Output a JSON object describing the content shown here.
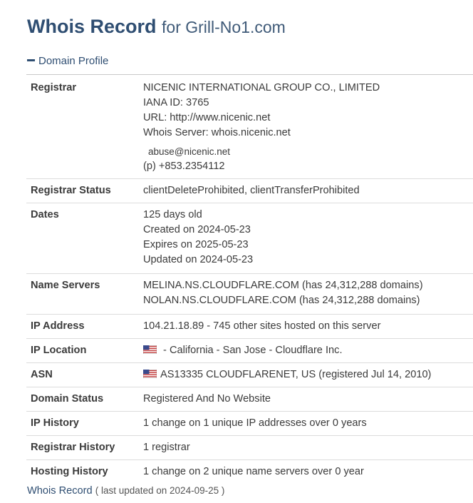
{
  "title": {
    "main": "Whois Record",
    "suffix": "for Grill-No1.com"
  },
  "section": {
    "label": "Domain Profile"
  },
  "rows": {
    "registrar": {
      "label": "Registrar",
      "name": "NICENIC INTERNATIONAL GROUP CO., LIMITED",
      "iana": "IANA ID: 3765",
      "url": "URL: http://www.nicenic.net",
      "whois_server": "Whois Server: whois.nicenic.net",
      "email": "abuse@nicenic.net",
      "phone": "(p)  +853.2354112"
    },
    "registrar_status": {
      "label": "Registrar Status",
      "value": "clientDeleteProhibited, clientTransferProhibited"
    },
    "dates": {
      "label": "Dates",
      "age": "125 days old",
      "created": "Created on 2024-05-23",
      "expires": "Expires on 2025-05-23",
      "updated": "Updated on 2024-05-23"
    },
    "name_servers": {
      "label": "Name Servers",
      "ns1": "MELINA.NS.CLOUDFLARE.COM (has 24,312,288 domains)",
      "ns2": "NOLAN.NS.CLOUDFLARE.COM (has 24,312,288 domains)"
    },
    "ip_address": {
      "label": "IP Address",
      "value": "104.21.18.89 - 745 other sites hosted on this server"
    },
    "ip_location": {
      "label": "IP Location",
      "value": " - California - San Jose - Cloudflare Inc."
    },
    "asn": {
      "label": "ASN",
      "value": "AS13335 CLOUDFLARENET, US (registered Jul 14, 2010)"
    },
    "domain_status": {
      "label": "Domain Status",
      "value": "Registered And No Website"
    },
    "ip_history": {
      "label": "IP History",
      "value": "1 change on 1 unique IP addresses over 0 years"
    },
    "registrar_history": {
      "label": "Registrar History",
      "value": "1 registrar"
    },
    "hosting_history": {
      "label": "Hosting History",
      "value": "1 change on 2 unique name servers over 0 year"
    }
  },
  "footer": {
    "link": "Whois Record",
    "note": "( last updated on 2024-09-25 )"
  },
  "icons": {
    "section_toggle": "minus-icon",
    "flag": "us-flag-icon"
  },
  "colors": {
    "title": "#2f4e72",
    "text": "#3b3b3b",
    "divider": "#dcdcdc"
  }
}
